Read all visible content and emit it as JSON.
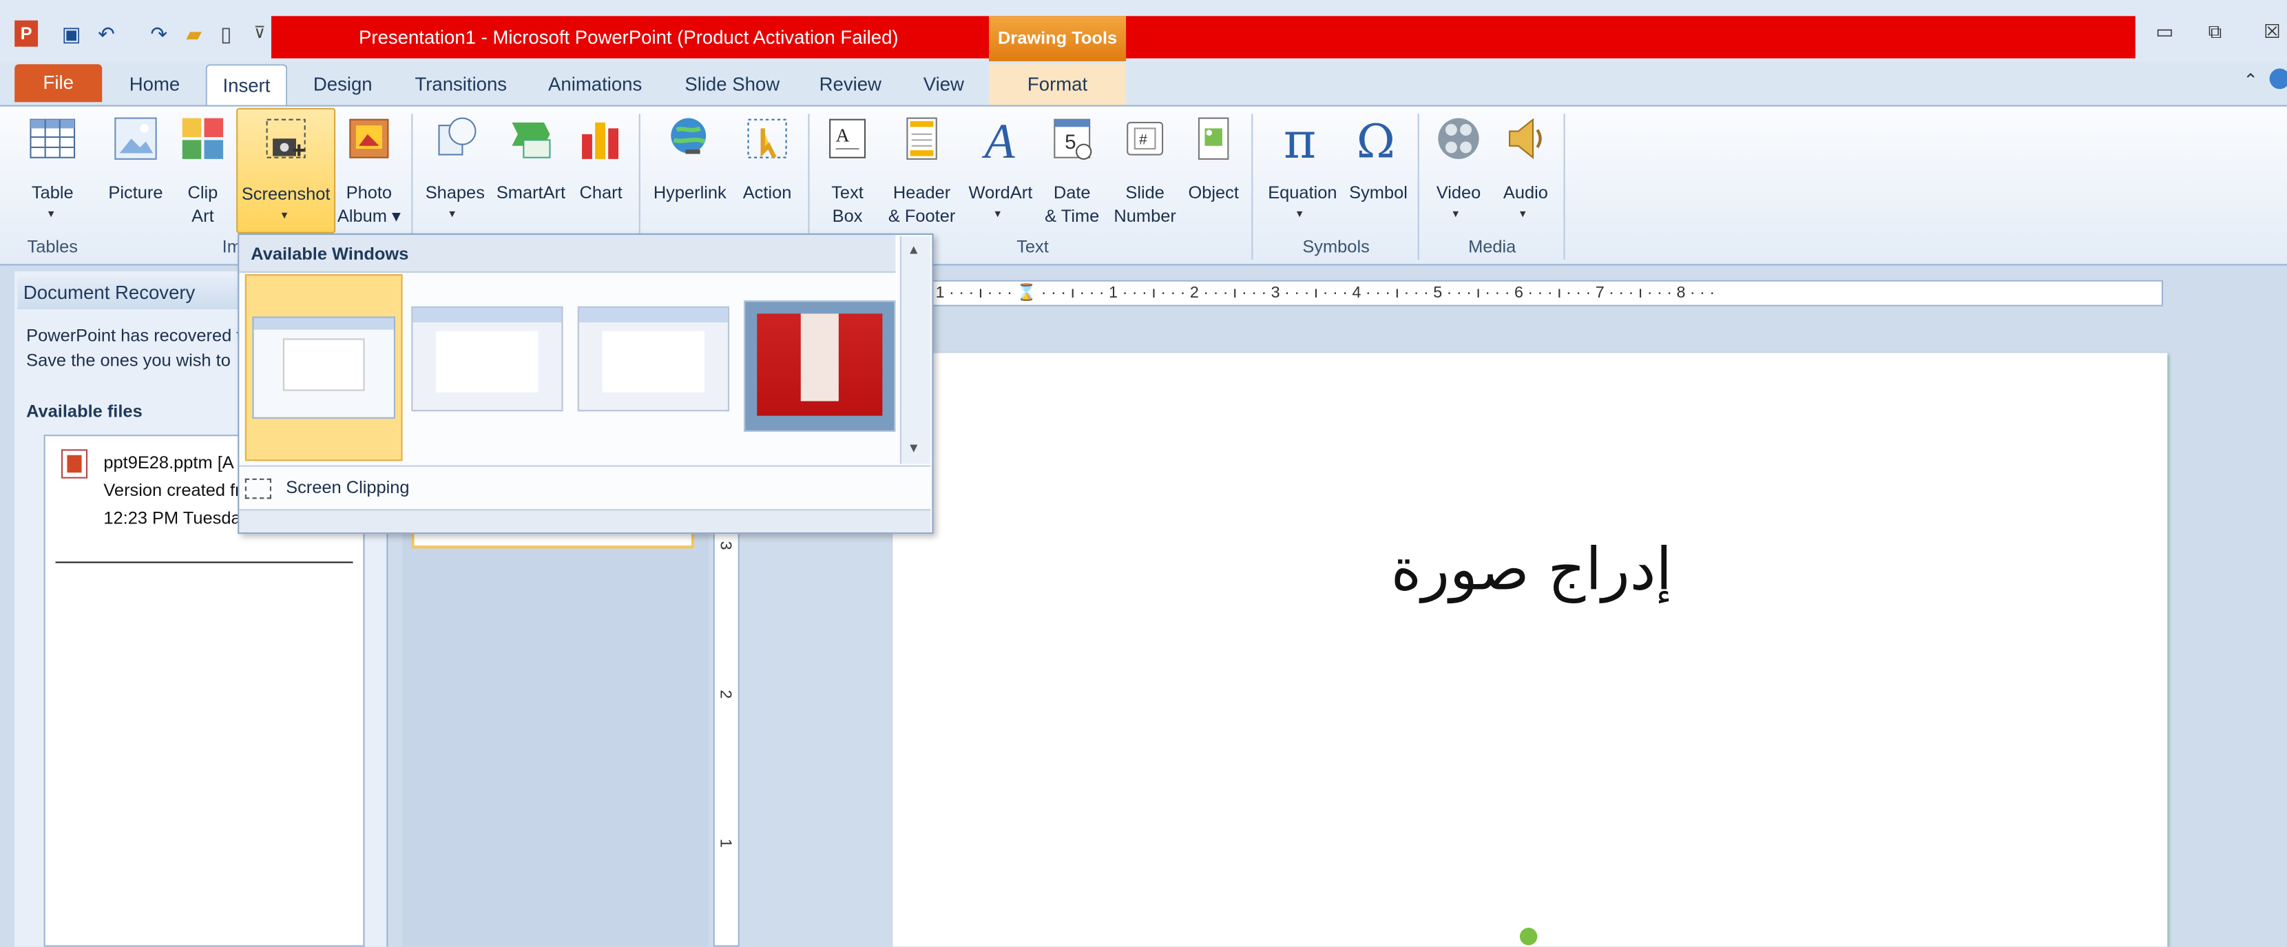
{
  "title": "Presentation1  -  Microsoft PowerPoint (Product Activation Failed)",
  "contextual_tab": "Drawing Tools",
  "tabs": [
    "File",
    "Home",
    "Insert",
    "Design",
    "Transitions",
    "Animations",
    "Slide Show",
    "Review",
    "View",
    "Format"
  ],
  "active_tab": "Insert",
  "ribbon": {
    "buttons": [
      "Table",
      "Picture",
      "Clip\nArt",
      "Screenshot",
      "Photo\nAlbum ▾",
      "Shapes",
      "SmartArt",
      "Chart",
      "Hyperlink",
      "Action",
      "Text\nBox",
      "Header\n& Footer",
      "WordArt",
      "Date\n& Time",
      "Slide\nNumber",
      "Object",
      "Equation",
      "Symbol",
      "Video",
      "Audio"
    ],
    "groups": [
      "Tables",
      "Im",
      "Text",
      "Symbols",
      "Media"
    ]
  },
  "dropdown": {
    "header": "Available Windows",
    "screen_clipping": "Screen Clipping"
  },
  "recovery": {
    "header": "Document Recovery",
    "text": "PowerPoint has recovered t\nSave the ones you wish to",
    "available_files": "Available files",
    "file_name": "ppt9E28.pptm  [A",
    "file_line2": "Version created fr",
    "file_line3": "12:23 PM Tuesda"
  },
  "ruler": "· · 1 · · · ı · · · ⌛ · · · ı · · · 1 · · · ı · · · 2 · · · ı · · · 3 · · · ı · · · 4 · · · ı · · · 5 · · · ı · · · 6 · · · ı · · · 7 · · · ı · · · 8 · · ·",
  "vruler_numbers": [
    "3",
    "2",
    "1"
  ],
  "slide": {
    "title": "إدراج صورة"
  },
  "colors": {
    "titlebar_red": "#e60000",
    "file_tab": "#d95a25",
    "accent": "#ffd35a"
  }
}
